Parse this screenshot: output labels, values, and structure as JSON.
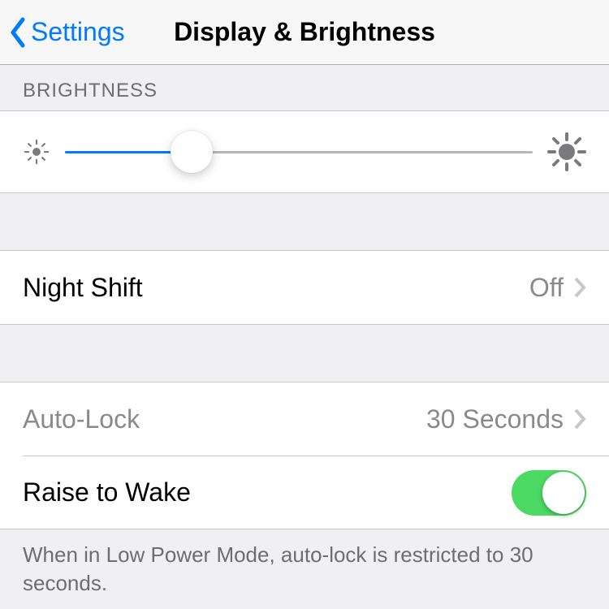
{
  "nav": {
    "back_label": "Settings",
    "title": "Display & Brightness"
  },
  "brightness": {
    "header": "BRIGHTNESS",
    "slider_percent": 27
  },
  "night_shift": {
    "label": "Night Shift",
    "value": "Off"
  },
  "auto_lock": {
    "label": "Auto-Lock",
    "value": "30 Seconds",
    "enabled": false
  },
  "raise_to_wake": {
    "label": "Raise to Wake",
    "on": true
  },
  "footer": "When in Low Power Mode, auto-lock is restricted to 30 seconds."
}
